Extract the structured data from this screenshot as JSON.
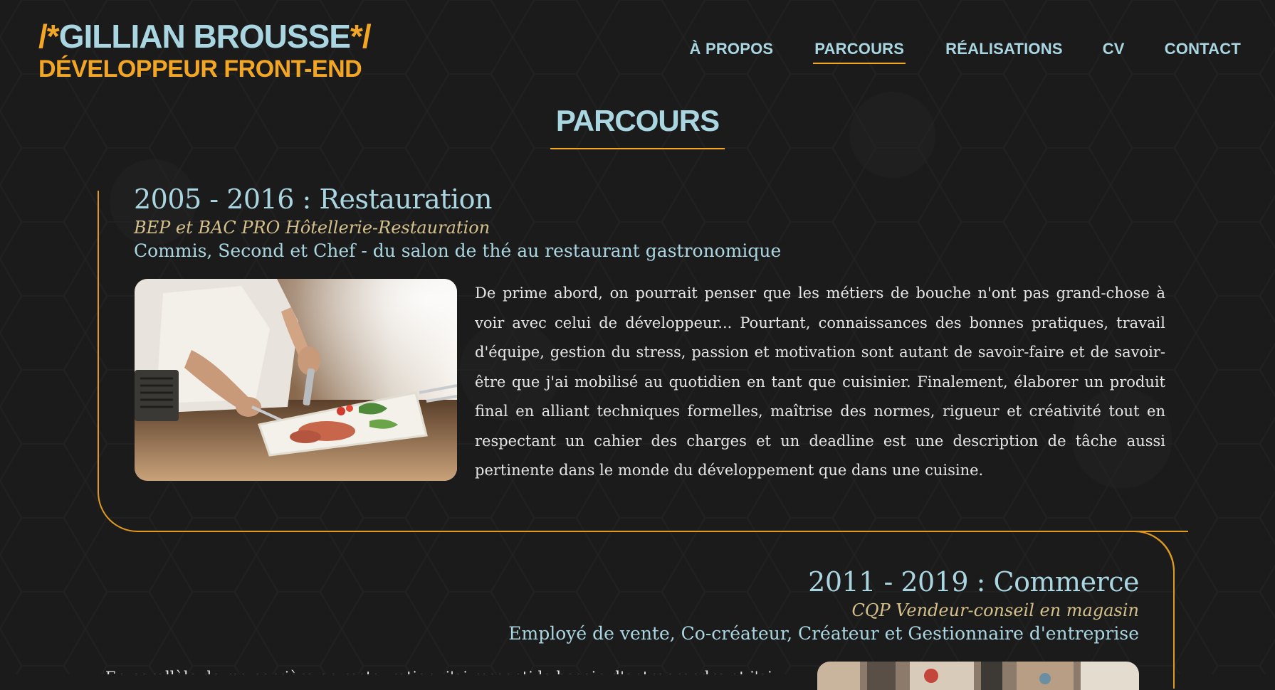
{
  "header": {
    "brand_prefix": "/*",
    "brand_name": "GILLIAN BROUSSE",
    "brand_suffix": "*/",
    "brand_role": "DÉVELOPPEUR FRONT-END"
  },
  "nav": {
    "items": [
      {
        "label": "À PROPOS",
        "active": false
      },
      {
        "label": "PARCOURS",
        "active": true
      },
      {
        "label": "RÉALISATIONS",
        "active": false
      },
      {
        "label": "CV",
        "active": false
      },
      {
        "label": "CONTACT",
        "active": false
      }
    ]
  },
  "section": {
    "title": "PARCOURS"
  },
  "entries": [
    {
      "title": "2005 - 2016 : Restauration",
      "degree": "BEP et BAC PRO Hôtellerie-Restauration",
      "role": "Commis, Second et Chef - du salon de thé au restaurant gastronomique",
      "image": "chef-plating-photo",
      "text": "De prime abord, on pourrait penser que les métiers de bouche n'ont pas grand-chose à voir avec celui de développeur... Pourtant, connaissances des bonnes pratiques, travail d'équipe, gestion du stress, passion et motivation sont autant de savoir-faire et de savoir-être que j'ai mobilisé au quotidien en tant que cuisinier. Finalement, élaborer un produit final en alliant techniques formelles, maîtrise des normes, rigueur et créativité tout en respectant un cahier des charges et un deadline est une description de tâche aussi pertinente dans le monde du développement que dans une cuisine."
    },
    {
      "title": "2011 - 2019 : Commerce",
      "degree": "CQP Vendeur-conseil en magasin",
      "role": "Employé de vente, Co-créateur, Créateur et Gestionnaire d'entreprise",
      "image": "shop-photo",
      "text": "En parallèle de ma carrière en restauration, j'ai ressenti le besoin d'entreprendre et j'ai"
    }
  ],
  "colors": {
    "background": "#1b1b1c",
    "accent": "#f2a623",
    "primary_text": "#a9d6e0",
    "degree_text": "#d4c08a",
    "body_text": "#e6e6e6"
  }
}
